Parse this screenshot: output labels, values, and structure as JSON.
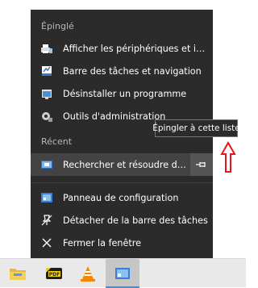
{
  "jumplist": {
    "pinned_header": "Épinglé",
    "pinned_items": [
      {
        "label": "Afficher les périphériques et imprimant…",
        "icon": "devices-printers-icon"
      },
      {
        "label": "Barre des tâches et navigation",
        "icon": "taskbar-settings-icon"
      },
      {
        "label": "Désinstaller un programme",
        "icon": "uninstall-program-icon"
      },
      {
        "label": "Outils d'administration",
        "icon": "admin-tools-icon"
      }
    ],
    "recent_header": "Récent",
    "recent_items": [
      {
        "label": "Rechercher et résoudre des prob…",
        "icon": "troubleshoot-icon"
      }
    ],
    "tasks": [
      {
        "label": "Panneau de configuration",
        "icon": "control-panel-icon"
      },
      {
        "label": "Détacher de la barre des tâches",
        "icon": "unpin-icon"
      },
      {
        "label": "Fermer la fenêtre",
        "icon": "close-icon"
      }
    ]
  },
  "tooltip": {
    "text": "Épingler à cette liste"
  },
  "colors": {
    "menu_bg": "#2b2b2b",
    "hover_bg": "#434343",
    "annotation_arrow": "#e8141b",
    "taskbar_bg": "#e9e9e9"
  }
}
